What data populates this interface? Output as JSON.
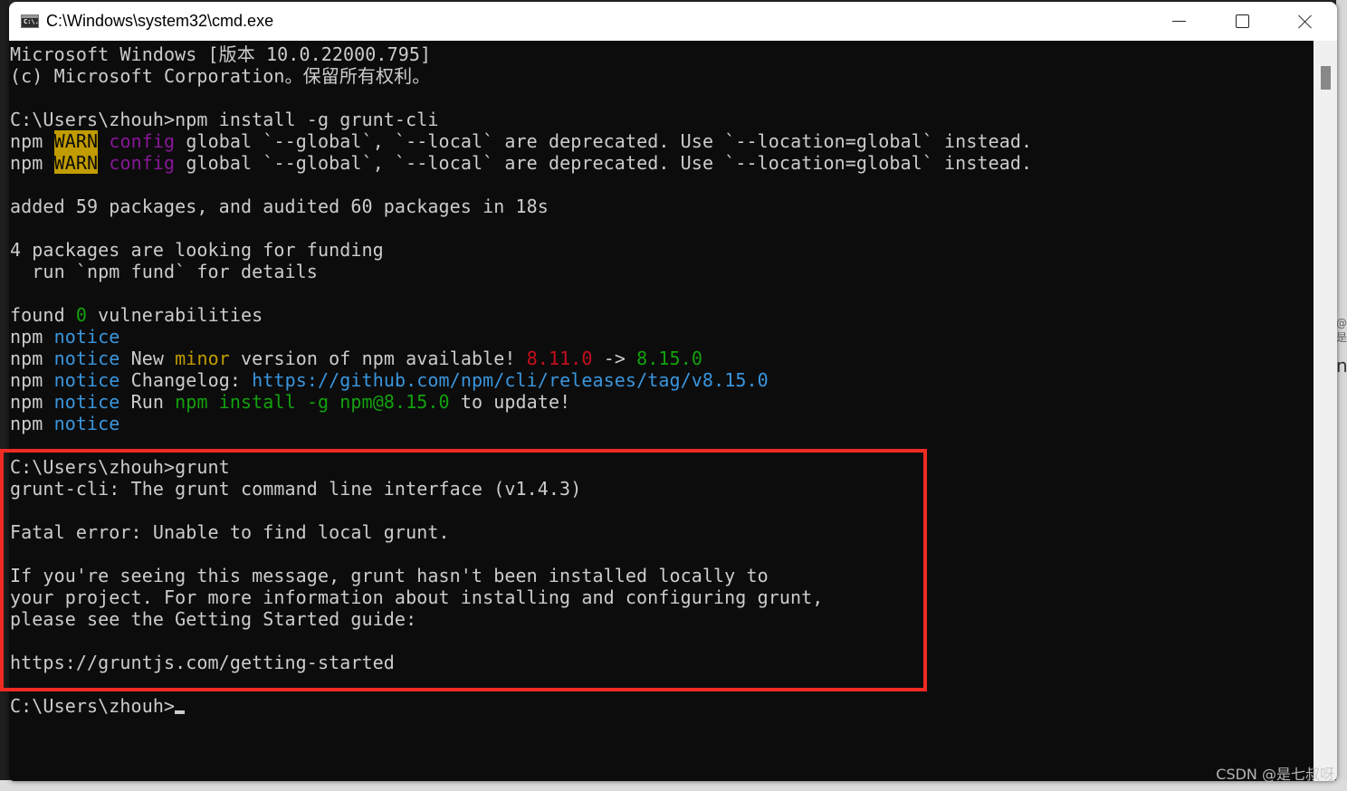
{
  "window": {
    "title": "C:\\Windows\\system32\\cmd.exe",
    "icon": "cmd-icon",
    "icon_text": "C:\\.",
    "controls": {
      "minimize": "minimize-icon",
      "maximize": "maximize-icon",
      "close": "close-icon"
    }
  },
  "colors": {
    "background": "#0c0c0c",
    "foreground": "#cccccc",
    "warn_bg": "#c19c00",
    "magenta": "#881798",
    "green": "#13a10e",
    "cyan": "#3a96dd",
    "red": "#c50f1f",
    "highlight_box": "#f02b22"
  },
  "console": {
    "lines": [
      [
        {
          "t": "Microsoft Windows [版本 10.0.22000.795]"
        }
      ],
      [
        {
          "t": "(c) Microsoft Corporation。保留所有权利。"
        }
      ],
      [
        {
          "t": ""
        }
      ],
      [
        {
          "t": "C:\\Users\\zhouh>npm install -g grunt-cli"
        }
      ],
      [
        {
          "t": "npm "
        },
        {
          "t": "WARN",
          "c": "warn"
        },
        {
          "t": " "
        },
        {
          "t": "config",
          "c": "magenta"
        },
        {
          "t": " global `--global`, `--local` are deprecated. Use `--location=global` instead."
        }
      ],
      [
        {
          "t": "npm "
        },
        {
          "t": "WARN",
          "c": "warn"
        },
        {
          "t": " "
        },
        {
          "t": "config",
          "c": "magenta"
        },
        {
          "t": " global `--global`, `--local` are deprecated. Use `--location=global` instead."
        }
      ],
      [
        {
          "t": ""
        }
      ],
      [
        {
          "t": "added 59 packages, and audited 60 packages in 18s"
        }
      ],
      [
        {
          "t": ""
        }
      ],
      [
        {
          "t": "4 packages are looking for funding"
        }
      ],
      [
        {
          "t": "  run `npm fund` for details"
        }
      ],
      [
        {
          "t": ""
        }
      ],
      [
        {
          "t": "found "
        },
        {
          "t": "0",
          "c": "green"
        },
        {
          "t": " vulnerabilities"
        }
      ],
      [
        {
          "t": "npm "
        },
        {
          "t": "notice",
          "c": "cyan"
        }
      ],
      [
        {
          "t": "npm "
        },
        {
          "t": "notice",
          "c": "cyan"
        },
        {
          "t": " New "
        },
        {
          "t": "minor",
          "c": "yellow"
        },
        {
          "t": " version of npm available! "
        },
        {
          "t": "8.11.0",
          "c": "red"
        },
        {
          "t": " -> "
        },
        {
          "t": "8.15.0",
          "c": "green"
        }
      ],
      [
        {
          "t": "npm "
        },
        {
          "t": "notice",
          "c": "cyan"
        },
        {
          "t": " Changelog: "
        },
        {
          "t": "https://github.com/npm/cli/releases/tag/v8.15.0",
          "c": "cyan"
        }
      ],
      [
        {
          "t": "npm "
        },
        {
          "t": "notice",
          "c": "cyan"
        },
        {
          "t": " Run "
        },
        {
          "t": "npm install -g npm@8.15.0",
          "c": "green"
        },
        {
          "t": " to update!"
        }
      ],
      [
        {
          "t": "npm "
        },
        {
          "t": "notice",
          "c": "cyan"
        }
      ],
      [
        {
          "t": ""
        }
      ],
      [
        {
          "t": "C:\\Users\\zhouh>grunt"
        }
      ],
      [
        {
          "t": "grunt-cli: The grunt command line interface (v1.4.3)"
        }
      ],
      [
        {
          "t": ""
        }
      ],
      [
        {
          "t": "Fatal error: Unable to find local grunt."
        }
      ],
      [
        {
          "t": ""
        }
      ],
      [
        {
          "t": "If you're seeing this message, grunt hasn't been installed locally to"
        }
      ],
      [
        {
          "t": "your project. For more information about installing and configuring grunt,"
        }
      ],
      [
        {
          "t": "please see the Getting Started guide:"
        }
      ],
      [
        {
          "t": ""
        }
      ],
      [
        {
          "t": "https://gruntjs.com/getting-started"
        }
      ],
      [
        {
          "t": ""
        }
      ],
      [
        {
          "t": "C:\\Users\\zhouh>"
        },
        {
          "cursor": true
        }
      ]
    ]
  },
  "watermark": "CSDN @是七叔呀",
  "background_fragments": {
    "right_1": "@是",
    "right_2": "n"
  }
}
